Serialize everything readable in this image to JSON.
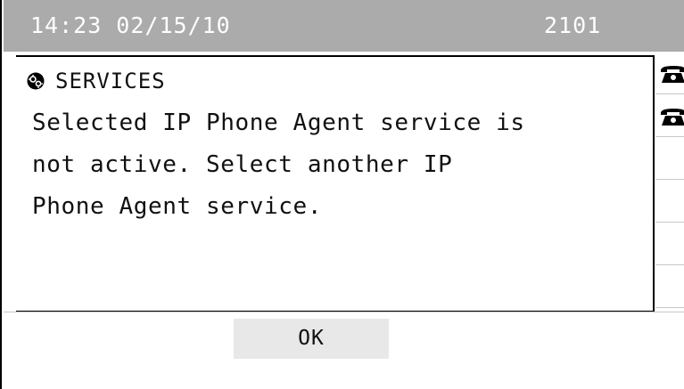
{
  "status_bar": {
    "datetime": "14:23 02/15/10",
    "extension": "2101"
  },
  "line_keys": [
    {
      "icon": "phone-icon"
    },
    {
      "icon": "phone-icon"
    },
    {
      "icon": ""
    },
    {
      "icon": ""
    },
    {
      "icon": ""
    },
    {
      "icon": ""
    }
  ],
  "dialog": {
    "icon": "services-icon",
    "title": "SERVICES",
    "message": "Selected IP Phone Agent service is\nnot active. Select another IP\nPhone Agent service."
  },
  "softkeys": {
    "ok_label": "OK"
  },
  "colors": {
    "status_bar_bg": "#ababab",
    "status_bar_text": "#ffffff",
    "softkey_bg": "#e8e8e8",
    "text": "#111111"
  }
}
